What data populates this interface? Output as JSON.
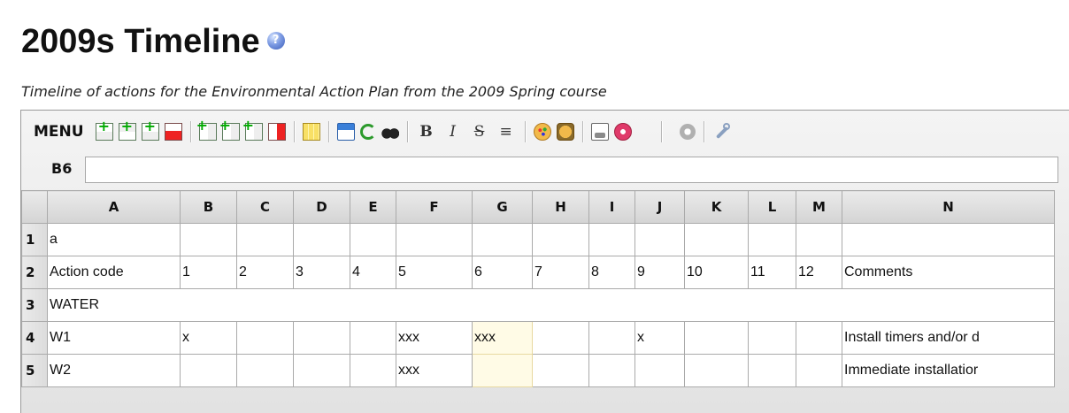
{
  "page": {
    "title": "2009s Timeline",
    "help_icon": "?",
    "subtitle": "Timeline of actions for the Environmental Action Plan from the 2009 Spring course"
  },
  "toolbar": {
    "menu_label": "MENU",
    "icons": [
      "insert-row-before-icon",
      "insert-row-after-icon",
      "insert-multiple-rows-icon",
      "delete-row-icon",
      "insert-column-before-icon",
      "insert-column-after-icon",
      "insert-multiple-columns-icon",
      "delete-column-icon",
      "add-sheet-icon",
      "save-icon",
      "refresh-icon",
      "find-icon",
      "bold-icon",
      "italic-icon",
      "strikethrough-icon",
      "align-icon",
      "color-palette-icon",
      "background-color-icon",
      "export-icon",
      "close-icon",
      "cancel-icon",
      "wrench-icon"
    ],
    "bold_glyph": "B",
    "italic_glyph": "I",
    "strike_glyph": "S",
    "align_glyph": "≡"
  },
  "cell_bar": {
    "cell_ref": "B6",
    "formula_value": ""
  },
  "grid": {
    "columns": [
      "A",
      "B",
      "C",
      "D",
      "E",
      "F",
      "G",
      "H",
      "I",
      "J",
      "K",
      "L",
      "M",
      "N"
    ],
    "rows": [
      {
        "num": "1",
        "cells": [
          "a",
          "",
          "",
          "",
          "",
          "",
          "",
          "",
          "",
          "",
          "",
          "",
          "",
          ""
        ]
      },
      {
        "num": "2",
        "cells": [
          "Action code",
          "1",
          "2",
          "3",
          "4",
          "5",
          "6",
          "7",
          "8",
          "9",
          "10",
          "11",
          "12",
          "Comments"
        ]
      },
      {
        "num": "3",
        "span_text": "WATER"
      },
      {
        "num": "4",
        "cells": [
          "W1",
          "x",
          "",
          "",
          "",
          "xxx",
          "xxx",
          "",
          "",
          "x",
          "",
          "",
          "",
          "Install timers and/or d"
        ]
      },
      {
        "num": "5",
        "cells": [
          "W2",
          "",
          "",
          "",
          "",
          "xxx",
          "",
          "",
          "",
          "",
          "",
          "",
          "",
          "Immediate installatior"
        ]
      }
    ]
  },
  "colors": {
    "selected_column_fill": "#fffbe6",
    "header_fill": "#dcdcdc",
    "title_color": "#111111"
  }
}
